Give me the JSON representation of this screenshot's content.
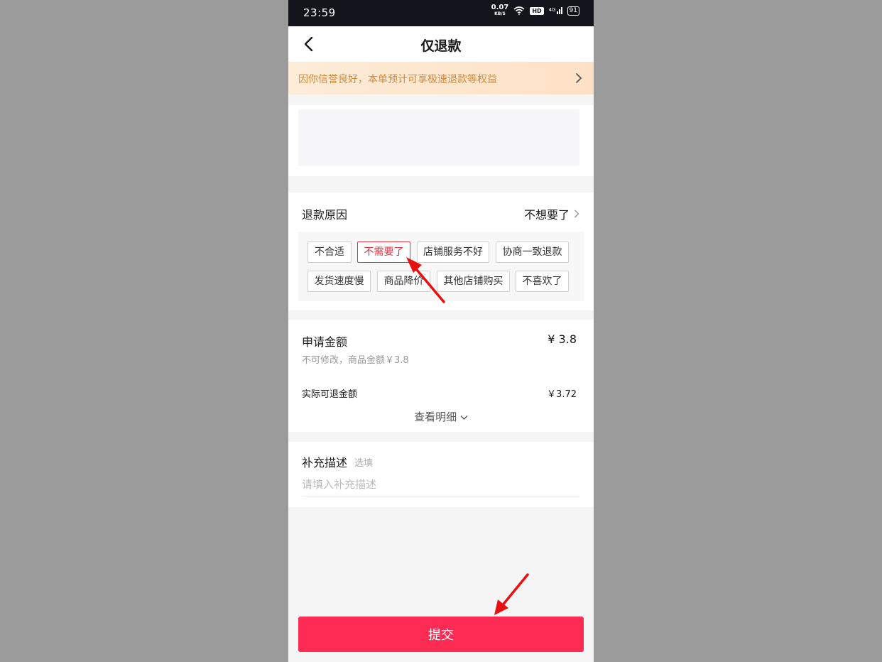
{
  "status_bar": {
    "time": "23:59",
    "net_speed": "0.07",
    "net_unit": "KB/S",
    "hd": "HD",
    "network": "4G",
    "battery": "91"
  },
  "nav": {
    "title": "仅退款"
  },
  "banner": {
    "text": "因你信誉良好，本单预计可享极速退款等权益"
  },
  "reason": {
    "label": "退款原因",
    "value": "不想要了",
    "tags": [
      "不合适",
      "不需要了",
      "店铺服务不好",
      "协商一致退款",
      "发货速度慢",
      "商品降价",
      "其他店铺购买",
      "不喜欢了"
    ],
    "selected": "不需要了"
  },
  "amount": {
    "label": "申请金额",
    "value": "¥ 3.8",
    "note": "不可修改，商品金额￥3.8",
    "actual_label": "实际可退金额",
    "actual_value": "￥3.72",
    "detail_link": "查看明细"
  },
  "description": {
    "label": "补充描述",
    "optional": "选填",
    "placeholder": "请填入补充描述"
  },
  "submit": {
    "label": "提交"
  },
  "colors": {
    "accent": "#fe2c55",
    "selected_tag": "#e03344",
    "banner_text": "#d08a3c",
    "annotation_arrow": "#e81010"
  }
}
